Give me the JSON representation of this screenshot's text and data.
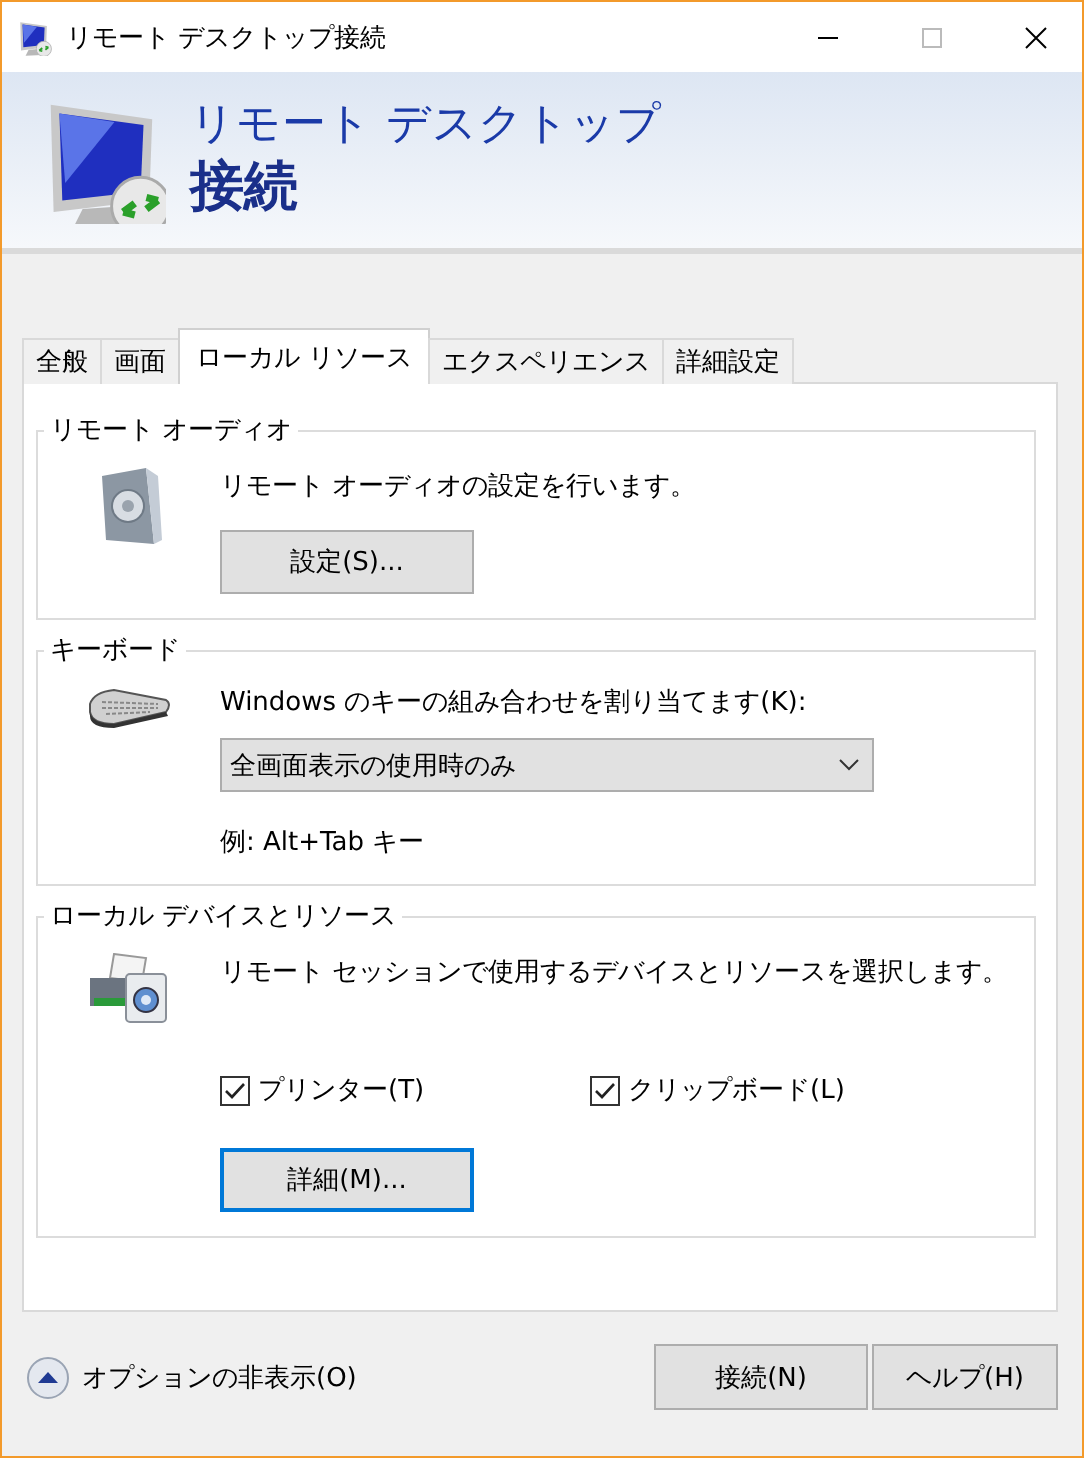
{
  "window": {
    "title": "リモート デスクトップ接続"
  },
  "banner": {
    "line1": "リモート デスクトップ",
    "line2": "接続"
  },
  "tabs": [
    {
      "label": "全般",
      "selected": false
    },
    {
      "label": "画面",
      "selected": false
    },
    {
      "label": "ローカル リソース",
      "selected": true
    },
    {
      "label": "エクスペリエンス",
      "selected": false
    },
    {
      "label": "詳細設定",
      "selected": false
    }
  ],
  "groups": [
    {
      "kind": "audio",
      "title": "リモート オーディオ",
      "description": "リモート オーディオの設定を行います。",
      "button": {
        "label": "設定(S)...",
        "focused": false
      }
    },
    {
      "kind": "keyboard",
      "title": "キーボード",
      "label": "Windows のキーの組み合わせを割り当てます(K):",
      "dropdown": {
        "value": "全画面表示の使用時のみ"
      },
      "example": "例: Alt+Tab キー"
    },
    {
      "kind": "devices",
      "title": "ローカル デバイスとリソース",
      "description": "リモート セッションで使用するデバイスとリソースを選択します。",
      "checkboxes": [
        {
          "label": "プリンター(T)",
          "checked": true
        },
        {
          "label": "クリップボード(L)",
          "checked": true
        }
      ],
      "button": {
        "label": "詳細(M)...",
        "focused": true
      }
    }
  ],
  "footer": {
    "options_toggle": "オプションの非表示(O)",
    "buttons": [
      "接続(N)",
      "ヘルプ(H)"
    ]
  }
}
